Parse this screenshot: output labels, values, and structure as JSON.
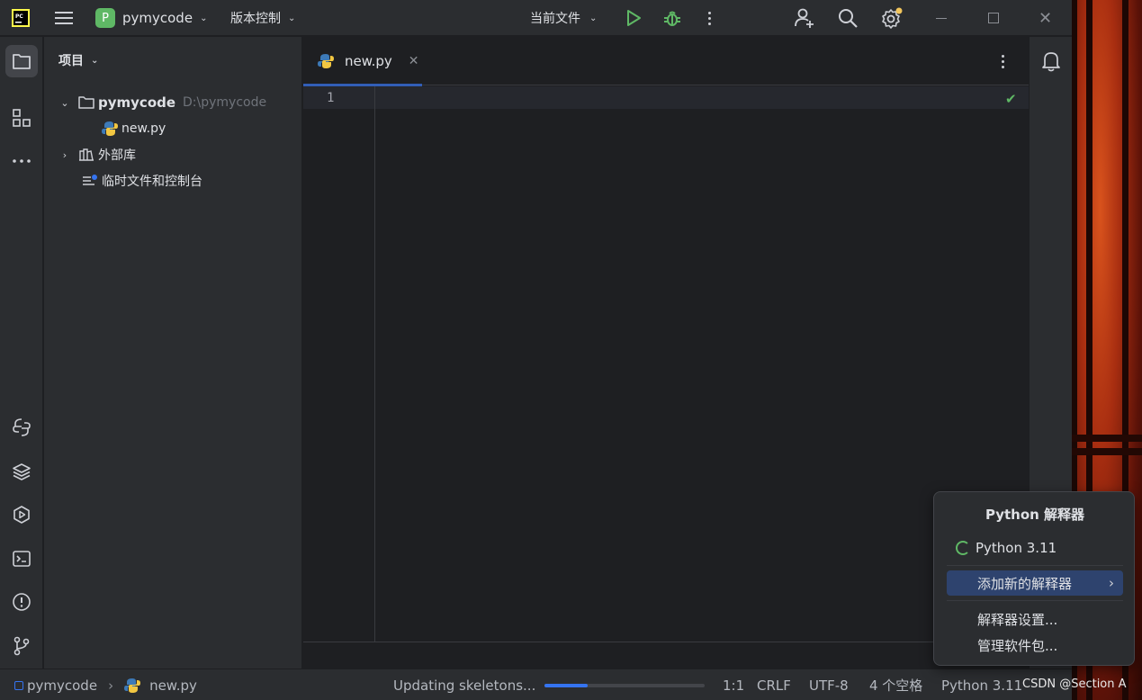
{
  "titlebar": {
    "project_badge": "P",
    "project_name": "pymycode",
    "vcs_label": "版本控制",
    "run_config": "当前文件"
  },
  "project_panel": {
    "header": "项目",
    "tree": [
      {
        "label": "pymycode",
        "hint": "D:\\pymycode"
      },
      {
        "label": "new.py"
      },
      {
        "label": "外部库"
      },
      {
        "label": "临时文件和控制台"
      }
    ]
  },
  "editor": {
    "tab_label": "new.py",
    "line_numbers": [
      "1"
    ]
  },
  "popup": {
    "title": "Python 解释器",
    "current": "Python 3.11",
    "add_new": "添加新的解释器",
    "settings": "解释器设置...",
    "packages": "管理软件包..."
  },
  "statusbar": {
    "breadcrumb_project": "pymycode",
    "breadcrumb_file": "new.py",
    "task": "Updating skeletons...",
    "progress": 0.27,
    "position": "1:1",
    "line_sep": "CRLF",
    "encoding": "UTF-8",
    "indent": "4 个空格",
    "interpreter": "Python 3.11"
  },
  "watermark": "CSDN @Section A",
  "colors": {
    "accent": "#3574f0",
    "run_green": "#5fb865",
    "background": "#1e1f22",
    "panel": "#2b2d30"
  }
}
